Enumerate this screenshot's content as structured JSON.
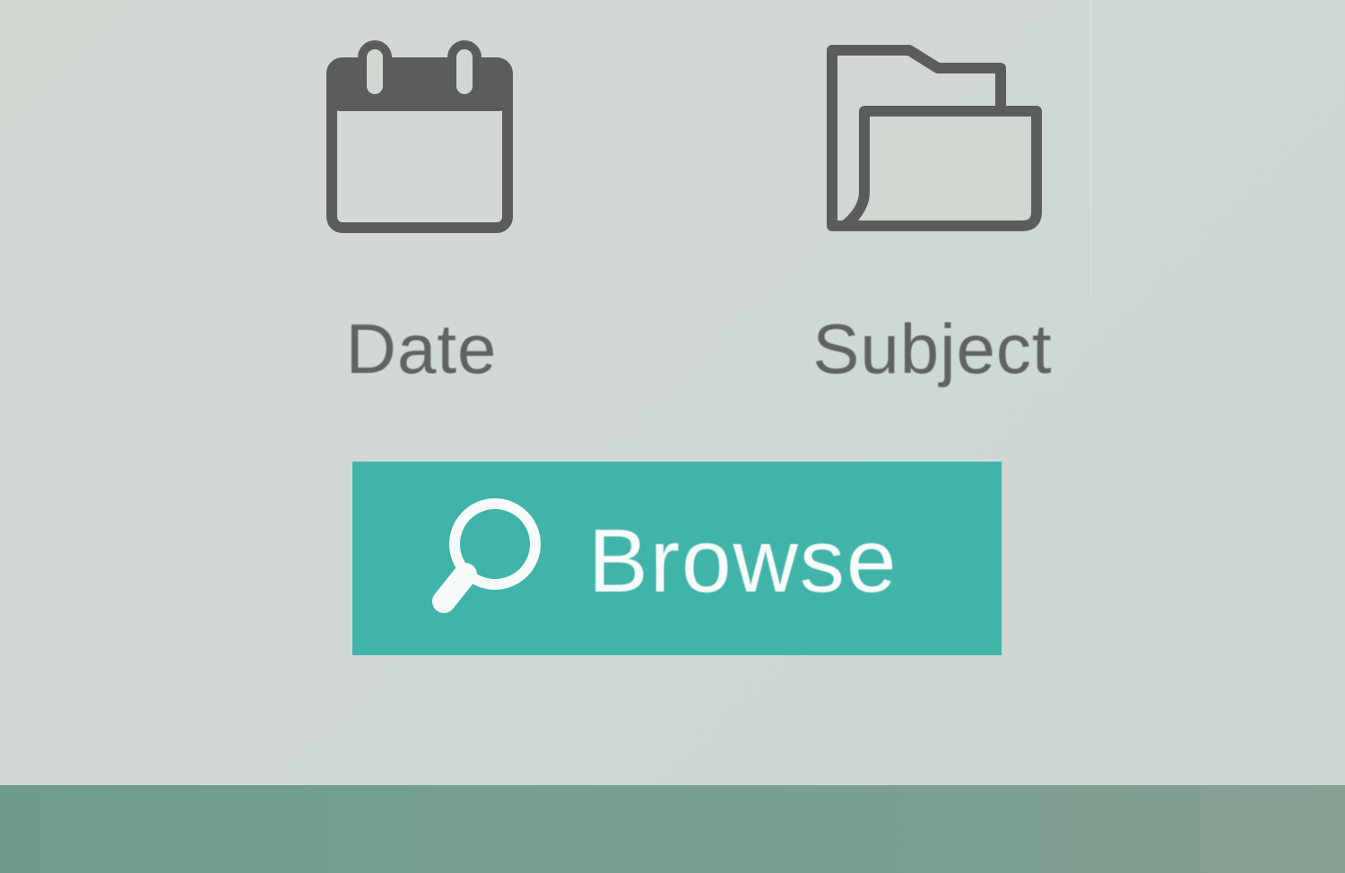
{
  "browse_options": [
    {
      "label": "Date",
      "icon": "calendar-icon"
    },
    {
      "label": "Subject",
      "icon": "folder-icon"
    }
  ],
  "browse_button": {
    "label": "Browse",
    "icon": "magnifier-icon"
  },
  "colors": {
    "accent": "#41b4aa",
    "icon_gray": "#5f6362",
    "footer": "#76a092",
    "background": "#d2d8d3"
  }
}
